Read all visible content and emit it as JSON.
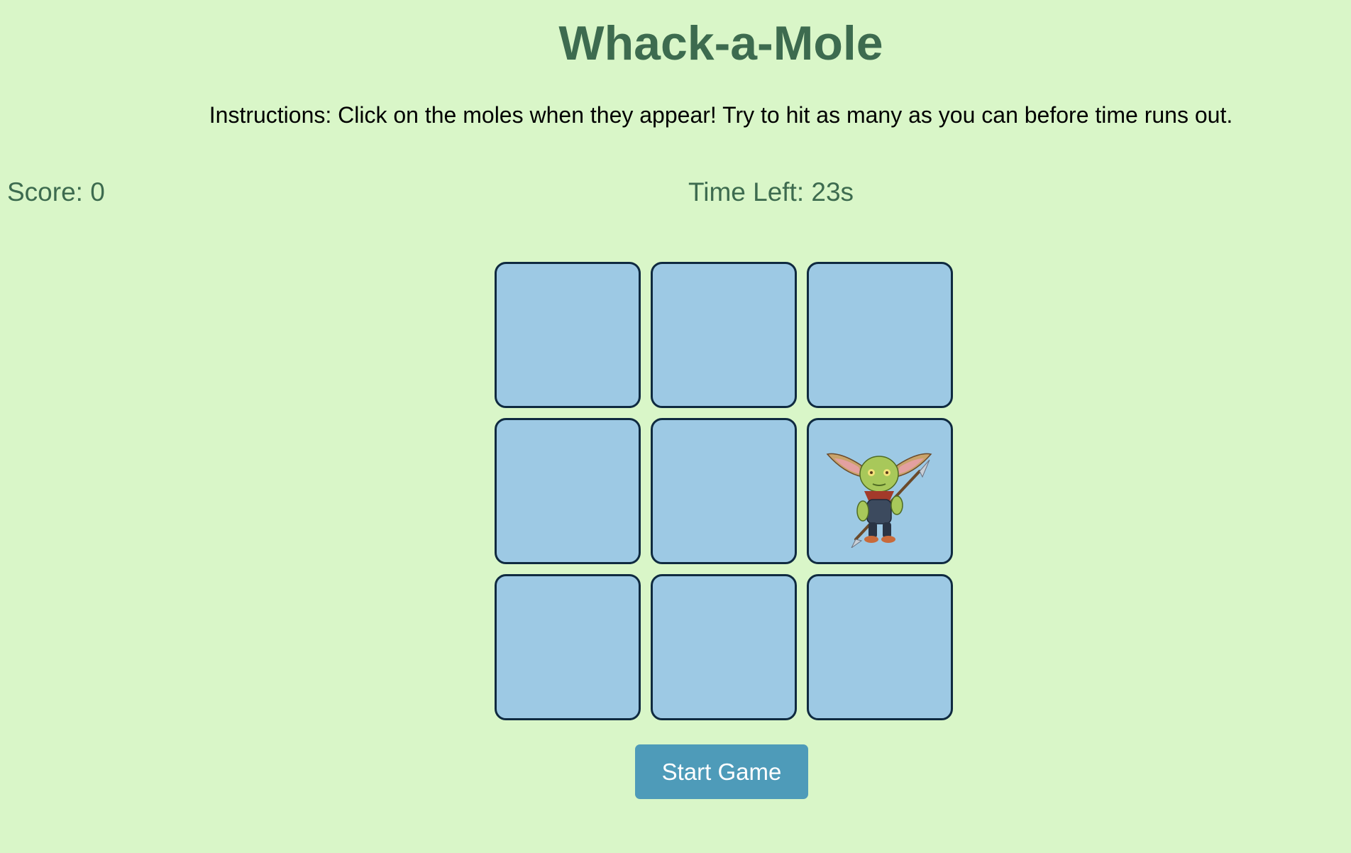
{
  "game": {
    "title": "Whack-a-Mole",
    "instructions": "Instructions: Click on the moles when they appear! Try to hit as many as you can before time runs out.",
    "score_text": "Score: 0",
    "time_left_text": "Time Left: 23s"
  },
  "grid": {
    "rows": 3,
    "columns": 3,
    "holes": [
      {
        "mole_visible": false
      },
      {
        "mole_visible": false
      },
      {
        "mole_visible": false
      },
      {
        "mole_visible": false
      },
      {
        "mole_visible": false
      },
      {
        "mole_visible": true,
        "mole_icon": "goblin-with-spear-icon"
      },
      {
        "mole_visible": false
      },
      {
        "mole_visible": false
      },
      {
        "mole_visible": false
      }
    ]
  },
  "controls": {
    "start_label": "Start Game"
  },
  "colors": {
    "background": "#d9f6c8",
    "title": "#3d6b4f",
    "hole_fill": "#9dc9e4",
    "hole_border": "#0f2a40",
    "button": "#4e9bb9"
  }
}
